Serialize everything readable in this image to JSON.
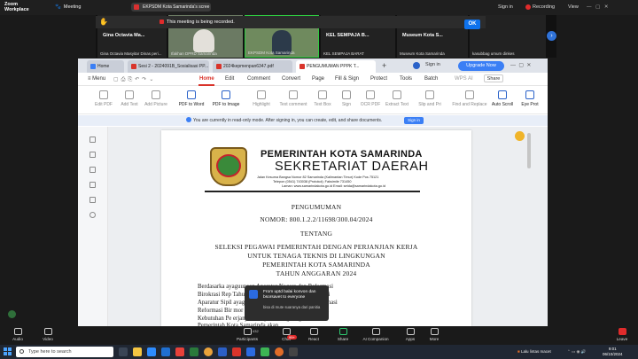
{
  "zoom": {
    "brand_line1": "Zoom",
    "brand_line2": "Workplace",
    "meeting_label": "Meeting",
    "share_title": "EKPSDM Kota Samarinda's scree",
    "sign_in": "Sign in",
    "recording": "Recording",
    "view": "View",
    "notification": "This meeting is being recorded.",
    "ok": "OK",
    "nav_next": "›"
  },
  "participants": [
    {
      "name": "Gina Octavia Ma...",
      "sub": "Gina Octavia Masyitar Dinas peri..."
    },
    {
      "name": "",
      "sub": "Ifakhan DPRD Samarinda"
    },
    {
      "name": "",
      "sub": "EKPSDM Kota Samarinda"
    },
    {
      "name": "KEL SEMPAJA B...",
      "sub": "KEL SEMPAJA BARAT"
    },
    {
      "name": "Museum Kota S...",
      "sub": "Museum Kota Samarinda"
    },
    {
      "name": "",
      "sub": "kasubbag umum dinkes"
    }
  ],
  "browser": {
    "tabs": [
      {
        "label": "Home"
      },
      {
        "label": "Sesi 2 - 2024091B_Sosialisasi PP..."
      },
      {
        "label": "2024kepmenpan6347.pdf"
      },
      {
        "label": "PENGUMUMAN PPPK T..."
      }
    ],
    "new_tab": "+",
    "sign_in": "Sign in",
    "upgrade": "Upgrade Now"
  },
  "menubar": {
    "menu": "Menu",
    "items": [
      "Home",
      "Edit",
      "Comment",
      "Convert",
      "Page",
      "Fill & Sign",
      "Protect",
      "Tools",
      "Batch"
    ],
    "wps_ai": "WPS AI",
    "share": "Share"
  },
  "toolbar": {
    "tools": [
      "Edit PDF",
      "Add Text",
      "Add Picture",
      "PDF to Word",
      "PDF to Image",
      "Highlight",
      "Text comment",
      "Text Box",
      "Sign",
      "OCR PDF",
      "Extract Text",
      "Slip and Pri",
      "Find and Replace",
      "Auto Scroll",
      "Eye Prot"
    ]
  },
  "banner": {
    "text": "You are currently in read-only mode. After signing in, you can create, edit, and share documents.",
    "button": "Sign in"
  },
  "document": {
    "org": "PEMERINTAH KOTA SAMARINDA",
    "unit": "SEKRETARIAT DAERAH",
    "address1": "Jalan Kesuma Bangsa Nomor 82 Samarinda (Kalimantan Timur) Kode Pos 75121",
    "address2": "Telepon (0541) 743038 (Protokol); Faksimile 731450",
    "address3": "Laman: www.samarindakota.go.id Email: setda@samarindakota.go.id",
    "title": "PENGUMUMAN",
    "number": "NOMOR: 800.1.2.2/11698/300.04/2024",
    "about": "TENTANG",
    "subject1": "SELEKSI PEGAWAI PEMERINTAH DENGAN PERJANJIAN KERJA",
    "subject2": "UNTUK TENAGA TEKNIS DI LINGKUNGAN",
    "subject3": "PEMERINTAH KOTA SAMARINDA",
    "subject4": "TAHUN ANGGARAN 2024",
    "body": [
      "Berdasarka                        ayaguunaan Aparatur Negara dan Reformasi",
      "Birokrasi Rep                        Tahun 2024 tentang Pengadaan Pegawai",
      "Aparatur Sipil                        ayagunaan Aparatur Negara dan Reformasi",
      "Reformasi Bir                        mor 329 Tahun 2024 tentang Penetapan",
      "Kebutuhan Pe                        erjanjian Kerja Di Lingkungan Instansi",
      "Pemerintah                          Kota Samarinda akan"
    ]
  },
  "popup": {
    "title": "From uptd balai konvon dan bsorsavet to everyone",
    "message": "bisa di mute suaranya dari panitia"
  },
  "controls": {
    "audio": "Audio",
    "video": "Video",
    "participants": "Participants",
    "participants_count": "432",
    "chat": "Chat",
    "chat_badge": "99+",
    "react": "React",
    "share": "Share",
    "ai": "AI Companion",
    "apps": "Apps",
    "more": "More",
    "leave": "Leave"
  },
  "taskbar": {
    "search": "Type here to search",
    "weather": "Lalu lintas macet",
    "time": "9:01",
    "date": "06/10/2024"
  }
}
